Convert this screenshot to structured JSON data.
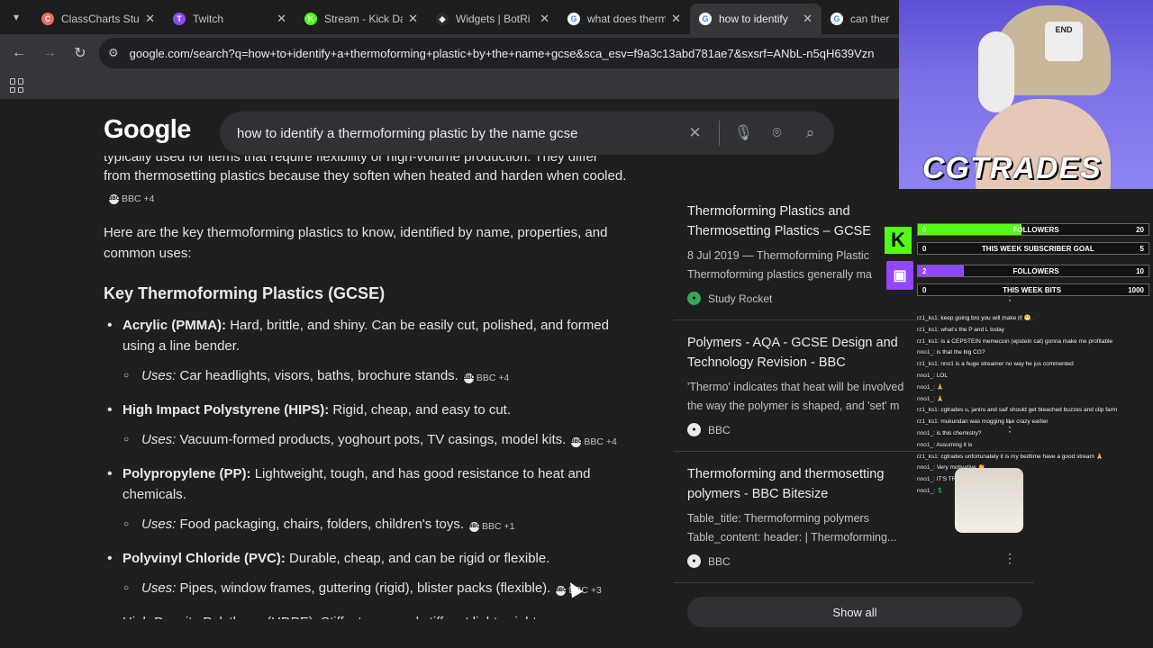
{
  "browser": {
    "tabs": [
      {
        "title": "ClassCharts Stud",
        "color": "#ea6c5a",
        "letter": "C"
      },
      {
        "title": "Twitch",
        "color": "#9146ff",
        "letter": "T"
      },
      {
        "title": "Stream - Kick Da",
        "color": "#53fc18",
        "letter": "K"
      },
      {
        "title": "Widgets | BotRi",
        "color": "#2d2d2d",
        "letter": "◆"
      },
      {
        "title": "what does therm",
        "color": "#ffffff",
        "letter": "G"
      },
      {
        "title": "how to identify",
        "color": "#ffffff",
        "letter": "G"
      },
      {
        "title": "can ther",
        "color": "#ffffff",
        "letter": "G"
      }
    ],
    "url": "google.com/search?q=how+to+identify+a+thermoforming+plastic+by+the+name+gcse&sca_esv=f9a3c13abd781ae7&sxsrf=ANbL-n5qH639Vzn"
  },
  "search": {
    "logo": "Google",
    "query": "how to identify a thermoforming plastic by the name gcse"
  },
  "overview": {
    "cut_line": "typically used for items that require flexibility or high-volume production. They differ",
    "intro": "from thermosetting plastics because they soften when heated and harden when cooled.",
    "intro_src": "BBC +4",
    "lead": "Here are the key thermoforming plastics to know, identified by name, properties, and common uses:",
    "heading": "Key Thermoforming Plastics (GCSE)",
    "uses_label": "Uses:",
    "items": [
      {
        "name": "Acrylic (PMMA):",
        "desc": "Hard, brittle, and shiny. Can be easily cut, polished, and formed using a line bender.",
        "uses": "Car headlights, visors, baths, brochure stands.",
        "src": "BBC +4"
      },
      {
        "name": "High Impact Polystyrene (HIPS):",
        "desc": "Rigid, cheap, and easy to cut.",
        "uses": "Vacuum-formed products, yoghourt pots, TV casings, model kits.",
        "src": "BBC +4"
      },
      {
        "name": "Polypropylene (PP):",
        "desc": "Lightweight, tough, and has good resistance to heat and chemicals.",
        "uses": "Food packaging, chairs, folders, children's toys.",
        "src": "BBC +1"
      },
      {
        "name": "Polyvinyl Chloride (PVC):",
        "desc": "Durable, cheap, and can be rigid or flexible.",
        "uses": "Pipes, window frames, guttering (rigid), blister packs (flexible).",
        "src": "BBC +3"
      }
    ],
    "cut_bottom": "High Density Polythene (HDPE): Stiff, strong, and stiff, yet lightweight"
  },
  "sources": {
    "cards": [
      {
        "title": "Thermoforming Plastics and Thermosetting Plastics – GCSE",
        "snippet1": "8 Jul 2019 — Thermoforming Plastic",
        "snippet2": "Thermoforming plastics generally ma",
        "site": "Study Rocket",
        "logo_color": "#34a853"
      },
      {
        "title": "Polymers - AQA - GCSE Design and Technology Revision - BBC",
        "snippet1": "'Thermo' indicates that heat will be involved",
        "snippet2": "the way the polymer is shaped, and 'set' m",
        "site": "BBC",
        "logo_color": "#e8eaed"
      },
      {
        "title": "Thermoforming and thermosetting polymers - BBC Bitesize",
        "snippet1": "Table_title: Thermoforming polymers",
        "snippet2": "Table_content: header: | Thermoforming...",
        "site": "BBC",
        "logo_color": "#e8eaed"
      }
    ],
    "show_all": "Show all"
  },
  "overlay": {
    "brand": "CGTRADES",
    "cap_text": "END",
    "goals": [
      {
        "left": "0",
        "label": "FOLLOWERS",
        "right": "20",
        "fill": 0.45,
        "color": "#53fc18"
      },
      {
        "left": "0",
        "label": "THIS WEEK SUBSCRIBER GOAL",
        "right": "5",
        "fill": 0.0,
        "color": "#53fc18"
      },
      {
        "left": "2",
        "label": "FOLLOWERS",
        "right": "10",
        "fill": 0.2,
        "color": "#9146ff"
      },
      {
        "left": "0",
        "label": "THIS WEEK BITS",
        "right": "1000",
        "fill": 0.0,
        "color": "#9146ff"
      }
    ],
    "chat": [
      {
        "user": "rz1_ks1",
        "msg": ": keep going bro you will make it! 😁"
      },
      {
        "user": "rz1_ks1",
        "msg": ": what's the P and L today"
      },
      {
        "user": "rz1_ks1",
        "msg": ": is a CEPSTEIN memecoin (epstein cat) gonna make me profitable"
      },
      {
        "user": "nno1_",
        "msg": ": is that the big CG?"
      },
      {
        "user": "rz1_ks1",
        "msg": ": nno1 is a huge streamer no way he jus commented"
      },
      {
        "user": "nno1_",
        "msg": ": LOL"
      },
      {
        "user": "nno1_",
        "msg": ": 🙏"
      },
      {
        "user": "nno1_",
        "msg": ": 🙏"
      },
      {
        "user": "rz1_ks1",
        "msg": ": cgtrades u, janiru and saif should get bleached buzzes and clip farm"
      },
      {
        "user": "rz1_ks1",
        "msg": ": mukundan was mogging like crazy earlier"
      },
      {
        "user": "nno1_",
        "msg": ": is this chemistry?"
      },
      {
        "user": "nno1_",
        "msg": ": Assuming it is"
      },
      {
        "user": "rz1_ks1",
        "msg": ": cgtrades unfortunately it is my bedtime have a good stream 🙏"
      },
      {
        "user": "nno1_",
        "msg": ": Very motivative 👏"
      },
      {
        "user": "nno1_",
        "msg": ": IT'S TRUE!"
      },
      {
        "user": "nno1_",
        "msg": ": 💲"
      }
    ]
  }
}
